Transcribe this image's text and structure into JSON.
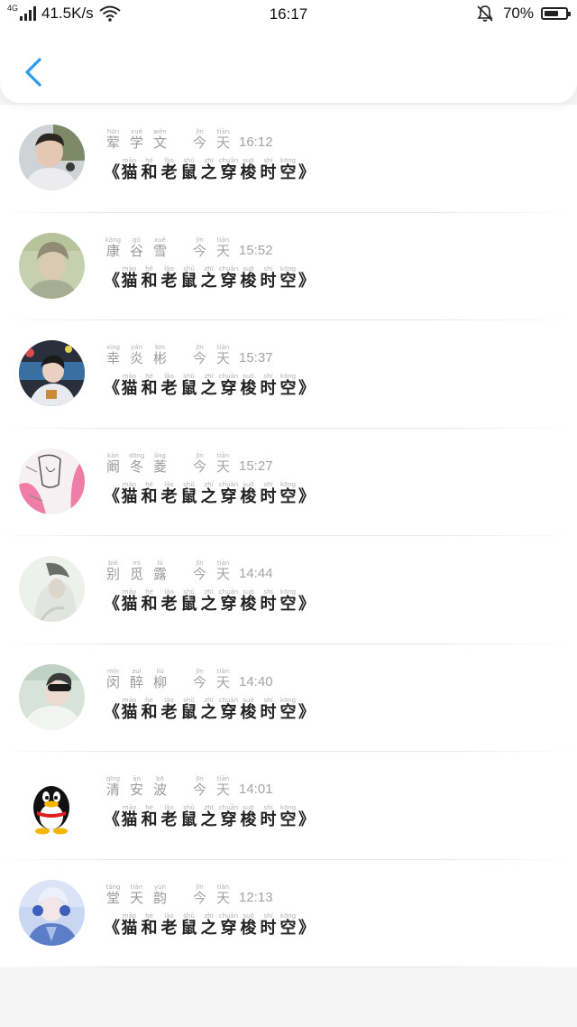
{
  "status_bar": {
    "network": "4G",
    "speed": "41.5K/s",
    "time": "16:17",
    "battery": "70%",
    "battery_level": 0.7
  },
  "header": {
    "back_icon": "chevron-left-icon",
    "accent": "#2b9af3"
  },
  "title_text": {
    "open": "《",
    "close": "》",
    "chars": [
      {
        "hz": "猫",
        "py": "māo"
      },
      {
        "hz": "和",
        "py": "hé"
      },
      {
        "hz": "老",
        "py": "lǎo"
      },
      {
        "hz": "鼠",
        "py": "shǔ"
      },
      {
        "hz": "之",
        "py": "zhī"
      },
      {
        "hz": "穿",
        "py": "chuān"
      },
      {
        "hz": "梭",
        "py": "suō"
      },
      {
        "hz": "时",
        "py": "shí"
      },
      {
        "hz": "空",
        "py": "kōng"
      }
    ]
  },
  "date_label": [
    {
      "hz": "今",
      "py": "jīn"
    },
    {
      "hz": "天",
      "py": "tiān"
    }
  ],
  "messages": [
    {
      "name": [
        {
          "hz": "荤",
          "py": "hūn"
        },
        {
          "hz": "学",
          "py": "xué"
        },
        {
          "hz": "文",
          "py": "wén"
        }
      ],
      "time": "16:12"
    },
    {
      "name": [
        {
          "hz": "康",
          "py": "kāng"
        },
        {
          "hz": "谷",
          "py": "gǔ"
        },
        {
          "hz": "雪",
          "py": "xuě"
        }
      ],
      "time": "15:52"
    },
    {
      "name": [
        {
          "hz": "幸",
          "py": "xìng"
        },
        {
          "hz": "炎",
          "py": "yán"
        },
        {
          "hz": "彬",
          "py": "bīn"
        }
      ],
      "time": "15:37"
    },
    {
      "name": [
        {
          "hz": "阚",
          "py": "kàn"
        },
        {
          "hz": "冬",
          "py": "dōng"
        },
        {
          "hz": "菱",
          "py": "líng"
        }
      ],
      "time": "15:27"
    },
    {
      "name": [
        {
          "hz": "别",
          "py": "bié"
        },
        {
          "hz": "觅",
          "py": "mì"
        },
        {
          "hz": "露",
          "py": "lù"
        }
      ],
      "time": "14:44"
    },
    {
      "name": [
        {
          "hz": "闵",
          "py": "mǐn"
        },
        {
          "hz": "醉",
          "py": "zuì"
        },
        {
          "hz": "柳",
          "py": "liǔ"
        }
      ],
      "time": "14:40"
    },
    {
      "name": [
        {
          "hz": "清",
          "py": "qīng"
        },
        {
          "hz": "安",
          "py": "ān"
        },
        {
          "hz": "波",
          "py": "bō"
        }
      ],
      "time": "14:01"
    },
    {
      "name": [
        {
          "hz": "堂",
          "py": "táng"
        },
        {
          "hz": "天",
          "py": "tiān"
        },
        {
          "hz": "韵",
          "py": "yùn"
        }
      ],
      "time": "12:13"
    }
  ]
}
